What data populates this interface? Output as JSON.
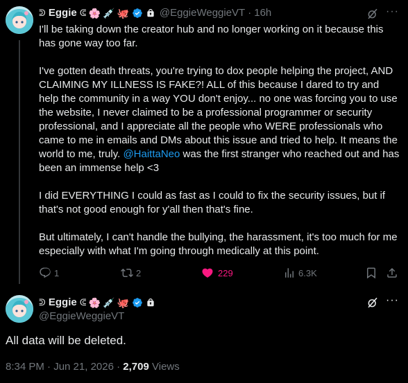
{
  "post": {
    "display_name": "Eggie",
    "name_prefix": "ᕲ",
    "name_suffix": "ᕳ",
    "emojis": [
      "🌸",
      "💉",
      "🐙"
    ],
    "handle": "@EggieWeggieVT",
    "time": "16h",
    "paragraphs": [
      "I'll be taking down the creator hub and no longer working on it because this has gone way too far.",
      "I've gotten death threats, you're trying to dox people helping the project, AND CLAIMING MY ILLNESS IS FAKE?! ALL of this because I dared to try and help the community in a way YOU don't enjoy... no one was forcing you to use the website, I never claimed to be a professional programmer or security professional, and I appreciate all the people who WERE professionals who came to me in emails and DMs about this issue and tried to help. It means the world to me, truly.",
      "I did EVERYTHING I could as fast as I could to fix the security issues, but if that's not good enough for y'all then that's fine.",
      "But ultimately, I can't handle the bullying, the harassment, it's too much for me especially with what I'm going through medically at this point."
    ],
    "mention": "@HaittaNeo",
    "mention_suffix": "was the first stranger who reached out and has been an immense help <3",
    "replies": "1",
    "reposts": "2",
    "likes": "229",
    "views": "6.3K"
  },
  "reply": {
    "display_name": "Eggie",
    "name_prefix": "ᕲ",
    "name_suffix": "ᕳ",
    "emojis": [
      "🌸",
      "💉",
      "🐙"
    ],
    "handle": "@EggieWeggieVT",
    "text": "All data will be deleted.",
    "timestamp": "8:34 PM · Jun 21, 2026 ·",
    "view_count": "2,709",
    "views_label": "Views"
  },
  "colors": {
    "background": "#000000",
    "text": "#e7e9ea",
    "muted": "#71767b",
    "link": "#1d9bf0",
    "like": "#f91880",
    "verified": "#1d9bf0"
  }
}
